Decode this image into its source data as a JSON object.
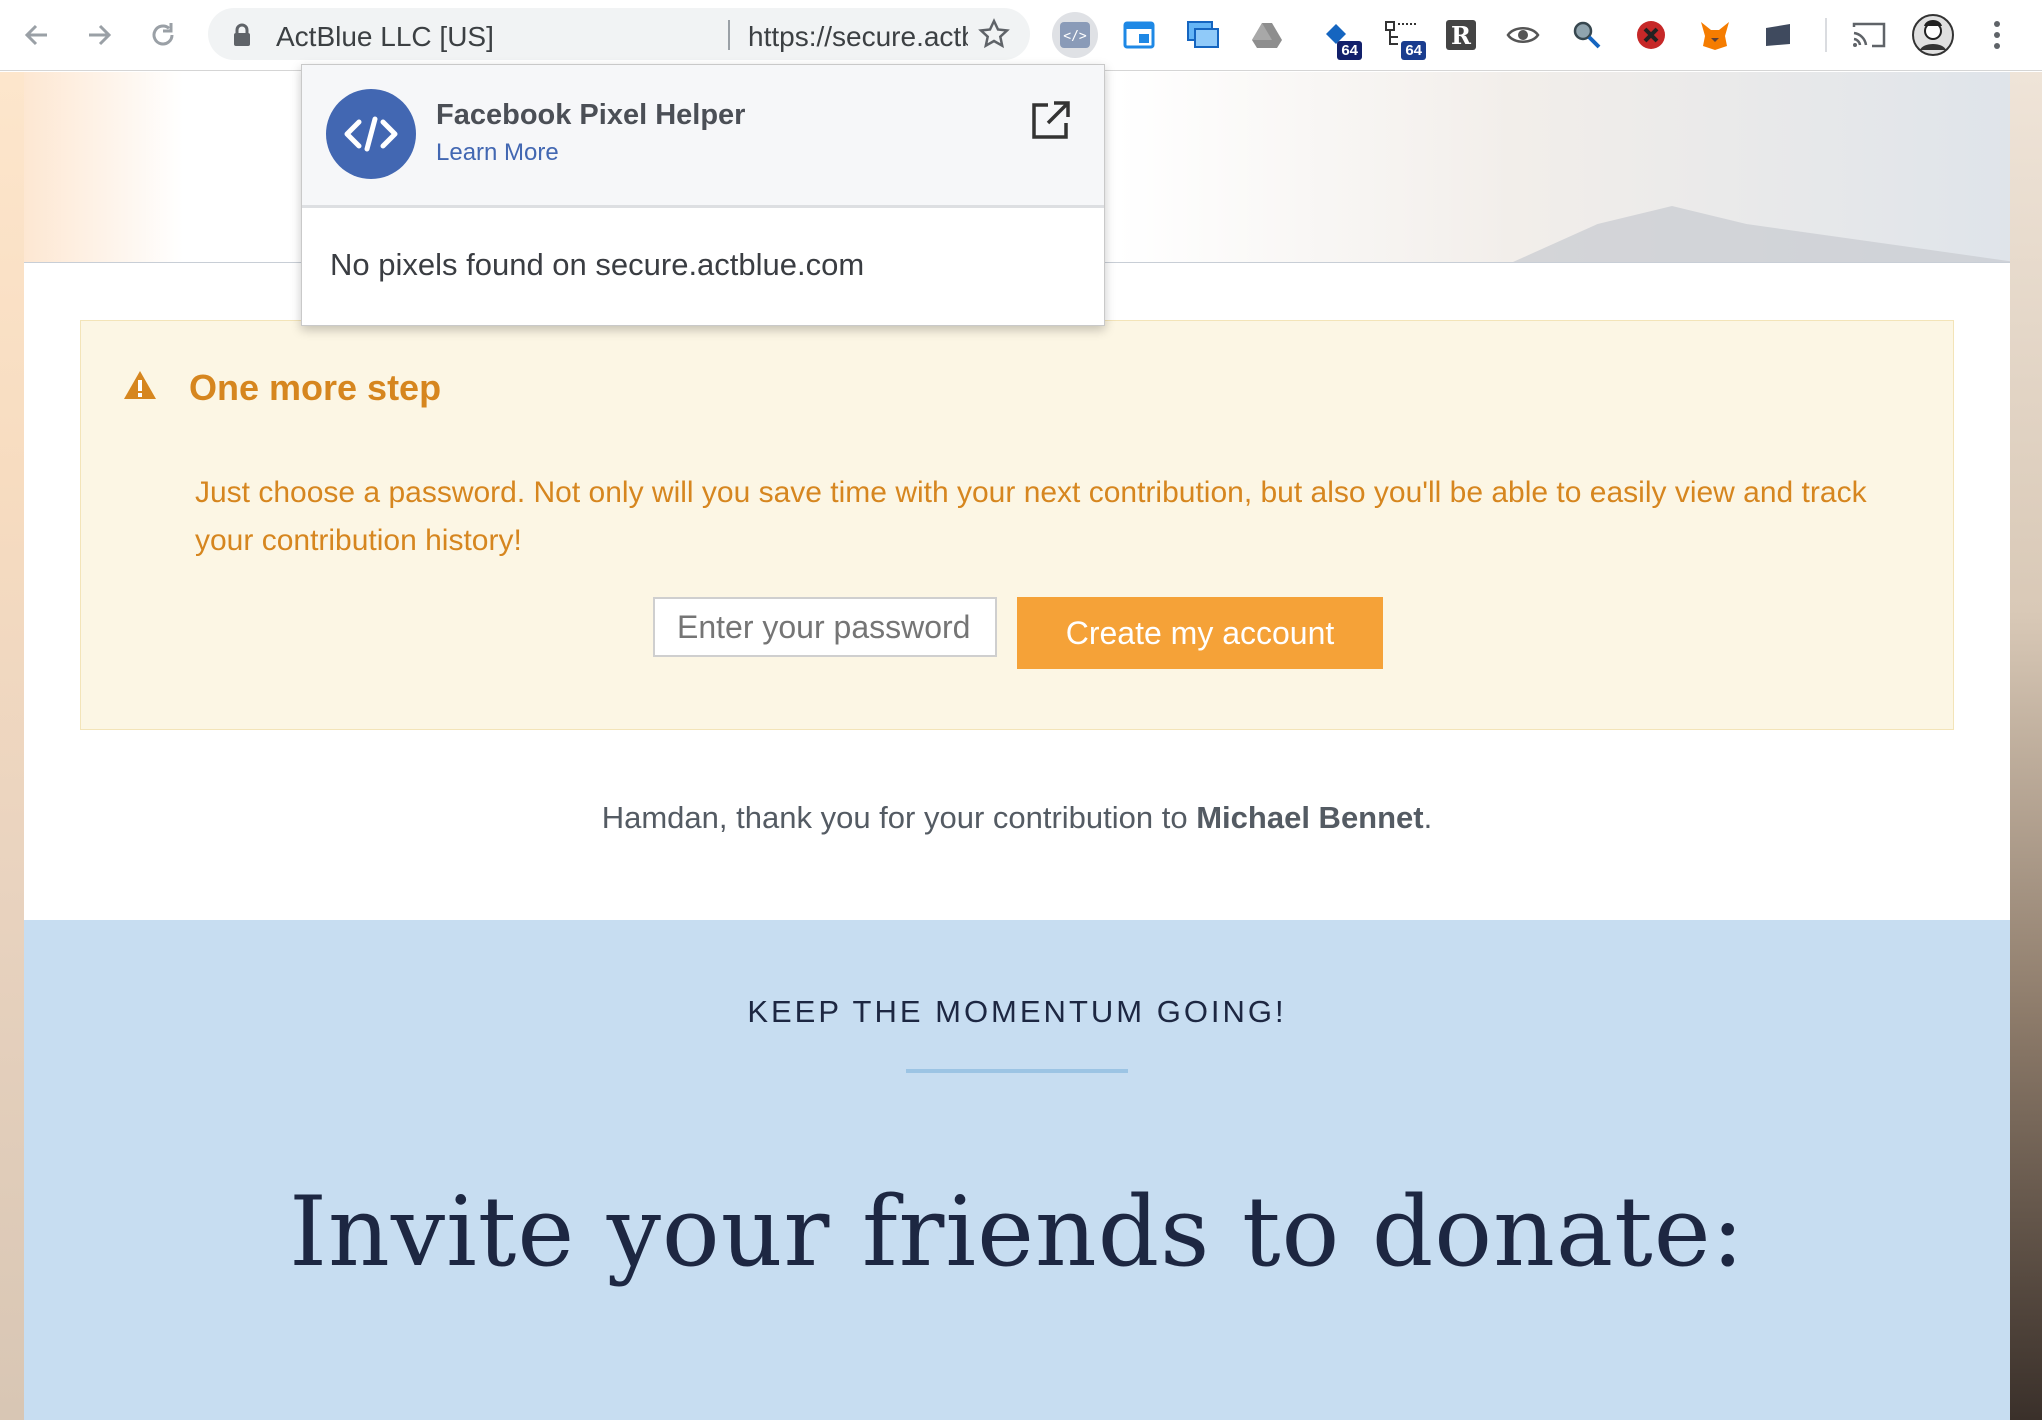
{
  "browser": {
    "site_identity": "ActBlue LLC [US]",
    "url": "https://secure.actblue.com/t...",
    "extension_badges": {
      "badge_a": "64",
      "badge_b": "64"
    },
    "extension_icons": [
      "pixel-helper-icon",
      "window-icon",
      "screenshot-icon",
      "drive-icon",
      "cookie-64-icon",
      "tree-64-icon",
      "r-icon",
      "eye-icon",
      "magnifier-icon",
      "red-shield-icon",
      "fox-icon",
      "folder-icon"
    ]
  },
  "popup": {
    "title": "Facebook Pixel Helper",
    "learn_more": "Learn More",
    "message": "No pixels found on secure.actblue.com"
  },
  "alert": {
    "title": "One more step",
    "body": "Just choose a password. Not only will you save time with your next contribution, but also you'll be able to easily view and track your contribution history!",
    "password_placeholder": "Enter your password",
    "button_label": "Create my account",
    "text_color": "#d6861f",
    "button_color": "#f5a238"
  },
  "thanks": {
    "prefix": "Hamdan, thank you for your contribution to ",
    "recipient": "Michael Bennet",
    "suffix": "."
  },
  "momentum": {
    "kicker": "KEEP THE MOMENTUM GOING!",
    "headline": "Invite your friends to donate:",
    "background": "#c7ddf1"
  }
}
